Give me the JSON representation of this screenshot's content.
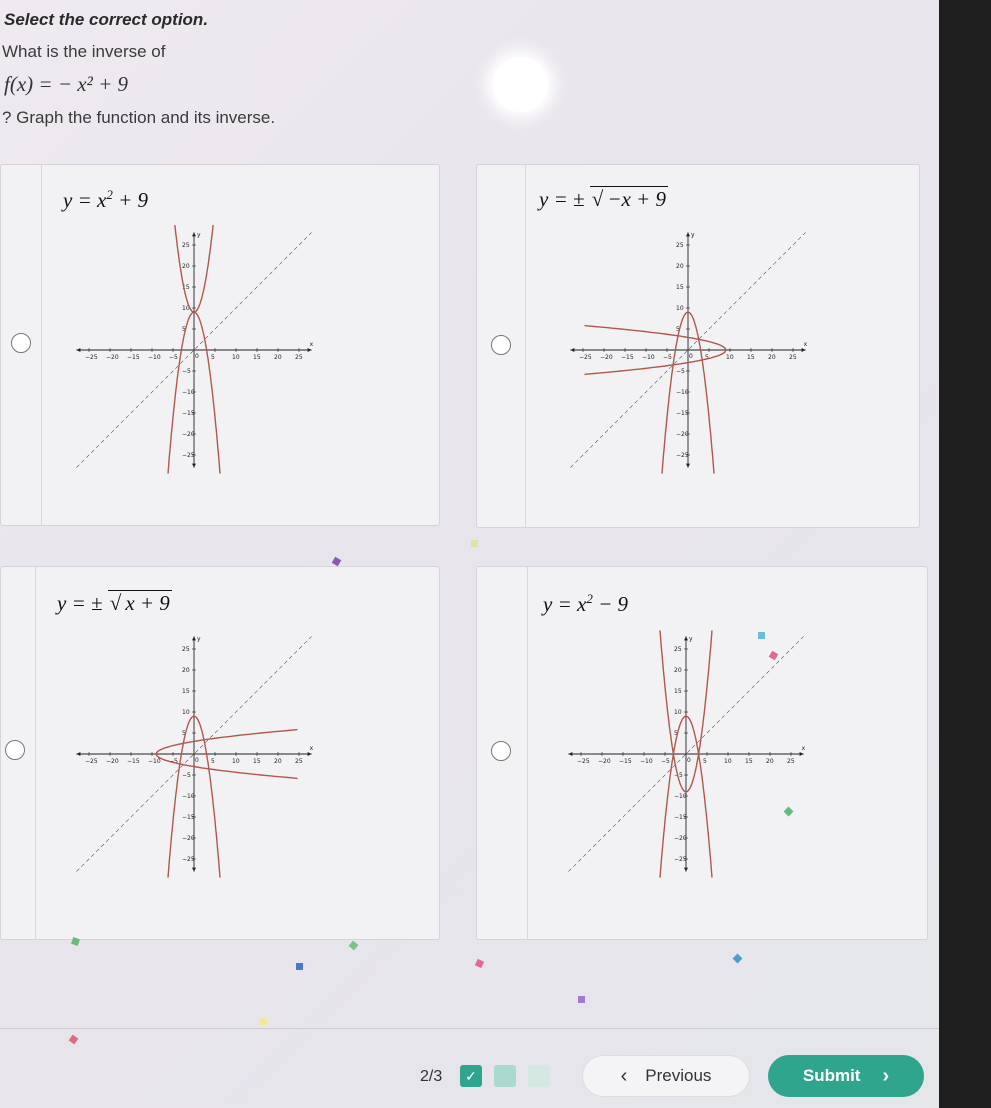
{
  "question": {
    "prompt": "Select the correct option.",
    "line1": "What is the inverse of",
    "function": "f(x) = − x² + 9",
    "line2": "? Graph the function and its inverse."
  },
  "options": [
    {
      "label_base": "y = x",
      "label_exp": "2",
      "label_tail": " + 9"
    },
    {
      "label_prefix": "y = ± ",
      "label_radicand": "−x + 9"
    },
    {
      "label_prefix": "y = ± ",
      "label_radicand": "x + 9"
    },
    {
      "label_base": "y = x",
      "label_exp": "2",
      "label_tail": " − 9"
    }
  ],
  "graph_ticks": [
    "−25",
    "−20",
    "−15",
    "−10",
    "−5",
    "0",
    "5",
    "10",
    "15",
    "20",
    "25"
  ],
  "graph_axis": {
    "x": "x",
    "y": "y"
  },
  "footer": {
    "progress": "2/3",
    "previous_label": "Previous",
    "submit_label": "Submit"
  },
  "colors": {
    "accent": "#2fa58e",
    "curve": "#b0584e",
    "step_done": "#2fa58e"
  }
}
